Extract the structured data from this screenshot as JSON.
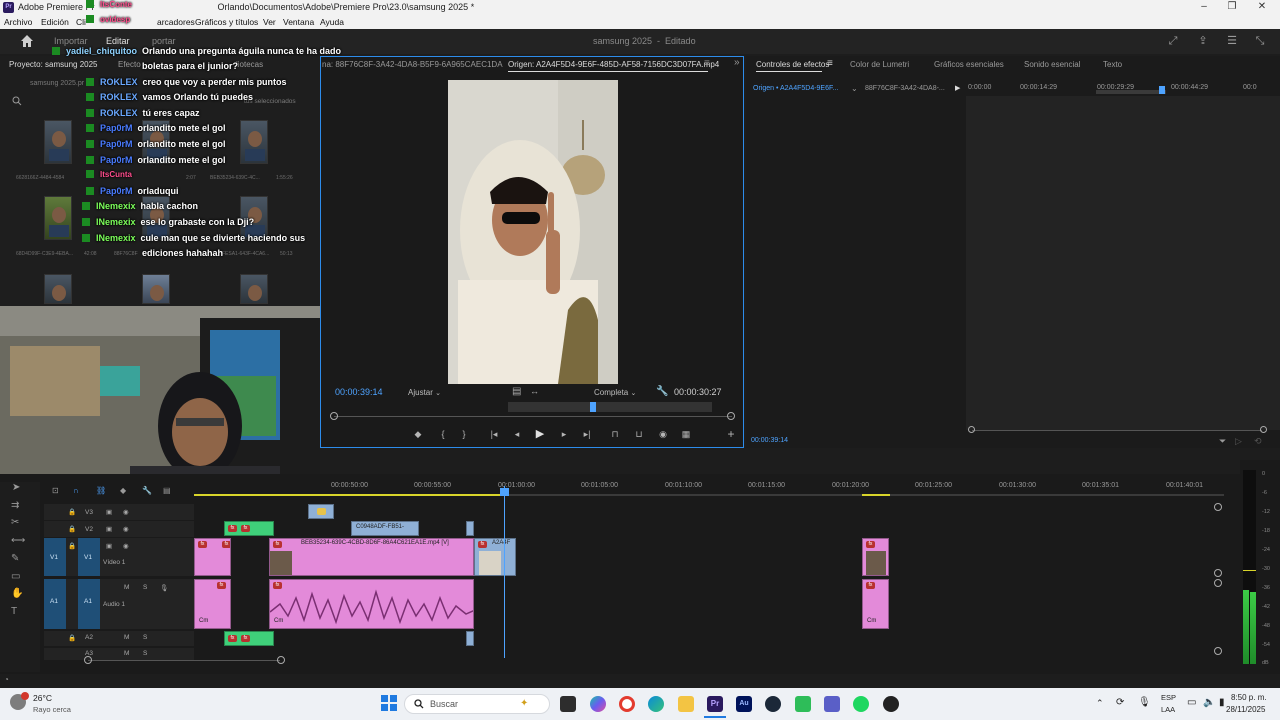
{
  "window": {
    "app_short": "Pr",
    "title_prefix": "Adobe Premiere Pr",
    "title_suffix": "Orlando\\Documentos\\Adobe\\Premiere Pro\\23.0\\samsung 2025 *"
  },
  "menu": {
    "archivo": "Archivo",
    "edicion": "Edición",
    "clip": "Cli",
    "marcadores": "arcadores",
    "graficos": "Gráficos y títulos",
    "ver": "Ver",
    "ventana": "Ventana",
    "ayuda": "Ayuda"
  },
  "header": {
    "importar": "Importar",
    "editar": "Editar",
    "exportar": "portar",
    "project_name": "samsung 2025",
    "status": "Editado"
  },
  "project_panel": {
    "tab": "Proyecto: samsung 2025",
    "tab2": "Efecto",
    "tab3": "liotecas",
    "breadcrumb": "samsung 2025.pr",
    "selected_info": "tos seleccionados",
    "clips": [
      {
        "name": "6628166Z-4484-4584",
        "dur": ""
      },
      {
        "name": "",
        "dur": "2:07"
      },
      {
        "name": "BEB35234-639C-4C...",
        "dur": "1:55:26"
      },
      {
        "name": "68D4D99F-C3E9-4EBA...",
        "dur": "42:08"
      },
      {
        "name": "88F76C8F",
        "dur": ""
      },
      {
        "name": "FESA1-643F-4CA6...",
        "dur": "50:13"
      }
    ]
  },
  "chat": [
    {
      "name": "ItsConte",
      "msg": "",
      "color": "#ff4d8d"
    },
    {
      "name": "ovidesp",
      "msg": "",
      "color": "#ff4d8d"
    },
    {
      "name": "yadiel_chiquitoo",
      "msg": "Orlando una pregunta águila nunca te ha dado",
      "color": "#8fd3ff"
    },
    {
      "name": "",
      "msg": "boletas para el junior?",
      "color": "#ffffff"
    },
    {
      "name": "ROKLEX",
      "msg": "creo que voy a perder mis puntos",
      "color": "#6aa8ff"
    },
    {
      "name": "ROKLEX",
      "msg": "vamos Orlando tú puedes",
      "color": "#6aa8ff"
    },
    {
      "name": "ROKLEX",
      "msg": "tú eres capaz",
      "color": "#6aa8ff"
    },
    {
      "name": "Pap0rM",
      "msg": "orlandito mete el gol",
      "color": "#4a7cff"
    },
    {
      "name": "Pap0rM",
      "msg": "orlandito mete el gol",
      "color": "#4a7cff"
    },
    {
      "name": "Pap0rM",
      "msg": "orlandito mete el gol",
      "color": "#4a7cff"
    },
    {
      "name": "ItsCunta",
      "msg": "",
      "color": "#ff4d8d"
    },
    {
      "name": "Pap0rM",
      "msg": "orladuqui",
      "color": "#4a7cff"
    },
    {
      "name": "INemexix",
      "msg": "habla cachon",
      "color": "#7cff5a"
    },
    {
      "name": "INemexix",
      "msg": "ese lo grabaste con la Dji?",
      "color": "#7cff5a"
    },
    {
      "name": "INemexix",
      "msg": "cule man que se divierte haciendo sus",
      "color": "#7cff5a"
    },
    {
      "name": "",
      "msg": "ediciones hahahah",
      "color": "#ffffff"
    }
  ],
  "program_monitor": {
    "tab_left": "na: 88F76C8F-3A42-4DA8-B5F9-6A965CAEC1DA",
    "tab_active": "Origen: A2A4F5D4-9E6F-485D-AF58-7156DC3D07FA.mp4",
    "timecode_in": "00:00:39:14",
    "fit": "Ajustar",
    "quality": "Completa",
    "timecode_out": "00:00:30:27",
    "accent": "#2d8ceb"
  },
  "effect_panel": {
    "tabs": [
      "Controles de efectos",
      "Color de Lumetri",
      "Gráficos esenciales",
      "Sonido esencial",
      "Texto"
    ],
    "origin": "Origen • A2A4F5D4-9E6F...",
    "clip": "88F76C8F-3A42-4DA8-...",
    "times": [
      "0:00:00",
      "00:00:14:29",
      "00:00:29:29",
      "00:00:44:29",
      "00:0"
    ],
    "timecode": "00:00:39:14"
  },
  "timeline": {
    "ruler": [
      "00:00:50:00",
      "00:00:55:00",
      "00:01:00:00",
      "00:01:05:00",
      "00:01:10:00",
      "00:01:15:00",
      "00:01:20:00",
      "00:01:25:00",
      "00:01:30:00",
      "00:01:35:01",
      "00:01:40:01"
    ],
    "tracks": {
      "v3": "V3",
      "v2": "V2",
      "v1": "V1",
      "video1": "Vídeo 1",
      "a1": "A1",
      "audio1": "Audio 1",
      "a2": "A2",
      "a3": "A3",
      "m": "M",
      "s": "S"
    },
    "clips": {
      "v2_clip": "C0948ADF-FB51-",
      "v1_clip": "BEB35234-639C-4CBD-8D6F-86A4C621EA1E.mp4 [V]",
      "v1_clip2": "A2A4F",
      "fx": "fx",
      "cam": "Cm"
    }
  },
  "meter": {
    "db": [
      "0",
      "-6",
      "-12",
      "-18",
      "-24",
      "-30",
      "-36",
      "-42",
      "-48",
      "-54",
      "dB"
    ]
  },
  "taskbar": {
    "temp": "26°C",
    "weather": "Rayo cerca",
    "search": "Buscar",
    "lang1": "ESP",
    "lang2": "LAA",
    "time": "8:50 p. m.",
    "date": "28/11/2025"
  }
}
